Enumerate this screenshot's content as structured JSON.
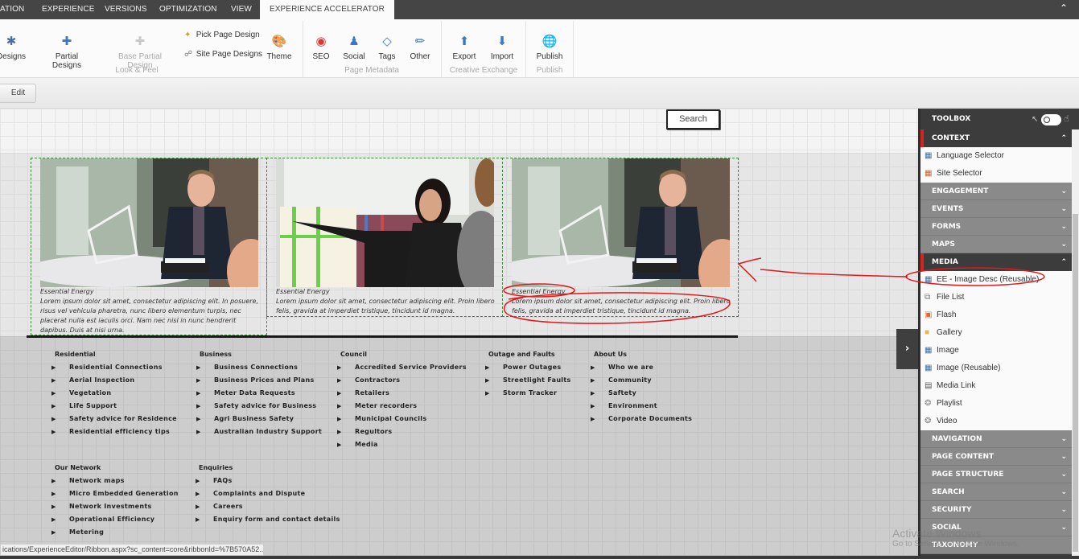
{
  "tabs": [
    {
      "label": "ATION"
    },
    {
      "label": "EXPERIENCE"
    },
    {
      "label": "VERSIONS"
    },
    {
      "label": "OPTIMIZATION"
    },
    {
      "label": "VIEW"
    },
    {
      "label": "EXPERIENCE ACCELERATOR",
      "active": true
    }
  ],
  "ribbon": {
    "buttons": {
      "page_designs": "Designs",
      "partial_designs": "Partial Designs",
      "base_partial_design": "Base Partial Design",
      "pick_page_design": "Pick Page Design",
      "site_page_designs": "Site Page Designs",
      "theme": "Theme",
      "seo": "SEO",
      "social": "Social",
      "tags": "Tags",
      "other": "Other",
      "export": "Export",
      "import": "Import",
      "publish": "Publish"
    },
    "groups": {
      "look_feel": "Look & Feel",
      "page_metadata": "Page Metadata",
      "creative_exchange": "Creative Exchange",
      "publish": "Publish"
    },
    "collapse_icon": "chevron-up-icon"
  },
  "toolbar": {
    "edit_label": "Edit"
  },
  "page": {
    "search_label": "Search",
    "cards": [
      {
        "caption": "Essential Energy",
        "description": "Lorem ipsum dolor sit amet, consectetur adipiscing elit. In posuere, risus vel vehicula pharetra, nunc libero elementum turpis, nec placerat nulla est iaculis orci. Nam nec nisl in nunc hendrerit dapibus. Duis at nisi urna.",
        "photo": "man-in-suit-meeting"
      },
      {
        "caption": "Essential Energy",
        "description": "Lorem ipsum dolor sit amet, consectetur adipiscing elit. Proin libero felis, gravida at imperdiet tristique, tincidunt id magna.",
        "photo": "woman-pointing-at-board"
      },
      {
        "caption": "Essential Energy",
        "description": "Lorem ipsum dolor sit amet, consectetur adipiscing elit. Proin libero felis, gravida at imperdiet tristique, tincidunt id magna.",
        "photo": "man-in-suit-meeting"
      }
    ],
    "footer": {
      "columns": [
        {
          "heading": "Residential",
          "items": [
            "Residential Connections",
            "Aerial Inspection",
            "Vegetation",
            "Life Support",
            "Safety advice for Residence",
            "Residential efficiency tips"
          ]
        },
        {
          "heading": "Business",
          "items": [
            "Business Connections",
            "Business Prices and Plans",
            "Meter Data Requests",
            "Safety advice for Business",
            "Agri Business Safety",
            "Australian Industry Support"
          ]
        },
        {
          "heading": "Council",
          "items": [
            "Accredited Service Providers",
            "Contractors",
            "Retailers",
            "Meter recorders",
            "Municipal Councils",
            "Regultors",
            "Media"
          ]
        },
        {
          "heading": "Outage and Faults",
          "items": [
            "Power Outages",
            "Streetlight Faults",
            "Storm Tracker"
          ]
        },
        {
          "heading": "About Us",
          "items": [
            "Who we are",
            "Community",
            "Saftety",
            "Environment",
            "Corporate Documents"
          ]
        },
        {
          "heading": "Our Network",
          "items": [
            "Network maps",
            "Micro Embedded Generation",
            "Network Investments",
            "Operational Efficiency",
            "Metering"
          ]
        },
        {
          "heading": "Enquiries",
          "items": [
            "FAQs",
            "Complaints and Dispute",
            "Careers",
            "Enquiry form and contact details"
          ]
        }
      ]
    }
  },
  "toolbox": {
    "title": "TOOLBOX",
    "sections": [
      {
        "label": "CONTEXT",
        "open": true,
        "items": [
          {
            "label": "Language Selector",
            "icon": "language-icon"
          },
          {
            "label": "Site Selector",
            "icon": "site-icon"
          }
        ]
      },
      {
        "label": "ENGAGEMENT",
        "open": false
      },
      {
        "label": "EVENTS",
        "open": false
      },
      {
        "label": "FORMS",
        "open": false
      },
      {
        "label": "MAPS",
        "open": false
      },
      {
        "label": "MEDIA",
        "open": true,
        "items": [
          {
            "label": "EE - Image Desc (Reusable)",
            "icon": "image-icon"
          },
          {
            "label": "File List",
            "icon": "file-list-icon"
          },
          {
            "label": "Flash",
            "icon": "flash-icon"
          },
          {
            "label": "Gallery",
            "icon": "gallery-icon"
          },
          {
            "label": "Image",
            "icon": "image-icon"
          },
          {
            "label": "Image (Reusable)",
            "icon": "image-icon"
          },
          {
            "label": "Media Link",
            "icon": "media-link-icon"
          },
          {
            "label": "Playlist",
            "icon": "playlist-icon"
          },
          {
            "label": "Video",
            "icon": "video-icon"
          }
        ]
      },
      {
        "label": "NAVIGATION",
        "open": false
      },
      {
        "label": "PAGE CONTENT",
        "open": false
      },
      {
        "label": "PAGE STRUCTURE",
        "open": false
      },
      {
        "label": "SEARCH",
        "open": false
      },
      {
        "label": "SECURITY",
        "open": false
      },
      {
        "label": "SOCIAL",
        "open": false
      },
      {
        "label": "TAXONOMY",
        "open": false
      }
    ]
  },
  "statusbar": {
    "url": "ications/ExperienceEditor/Ribbon.aspx?sc_content=core&ribbonId=%7B570A52..."
  },
  "watermark": {
    "line1": "Activate Windows",
    "line2": "Go to Settings to activate Windows."
  },
  "annotation_color": "#e0191b",
  "accent_red": "#d8241f"
}
